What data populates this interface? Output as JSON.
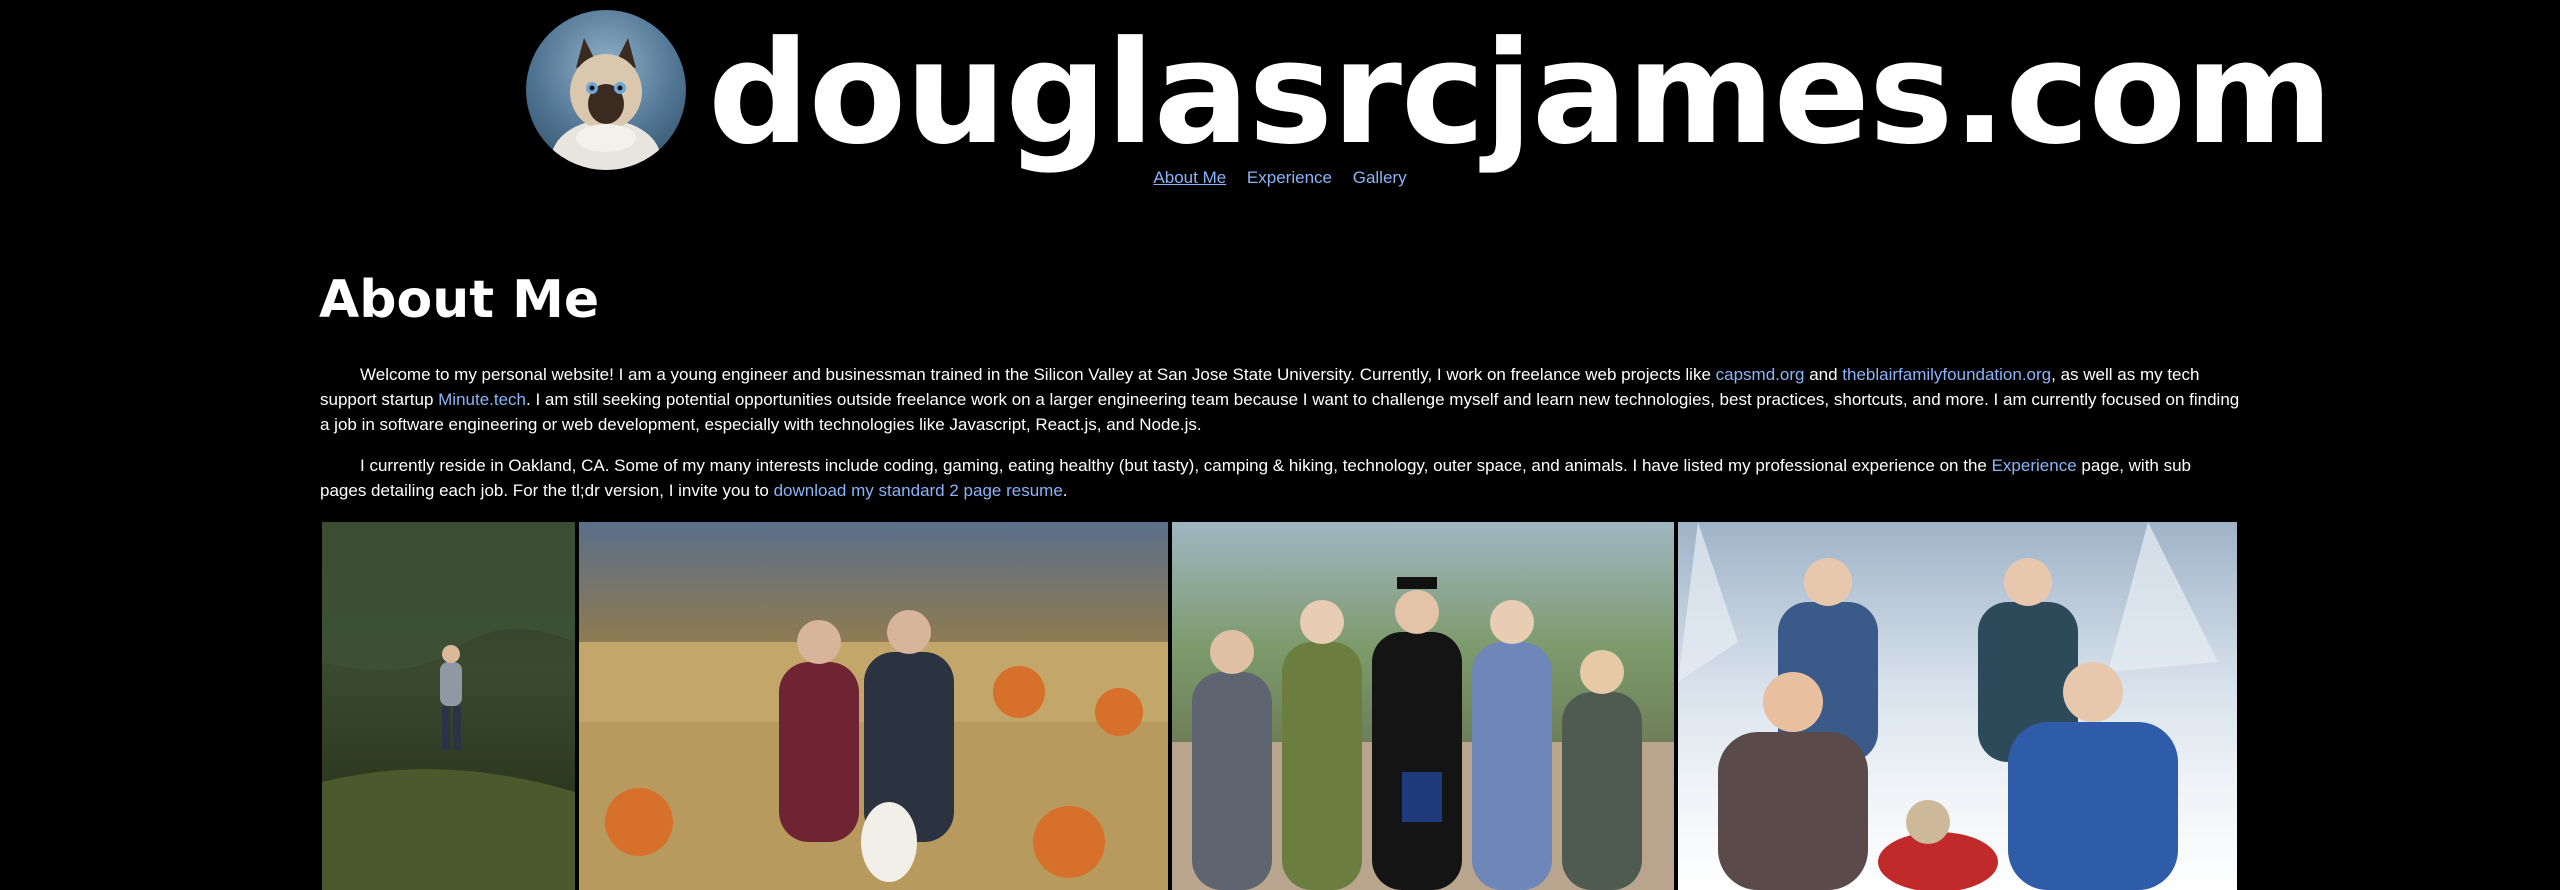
{
  "header": {
    "site_title": "douglasrcjames.com",
    "avatar_alt": "cat avatar"
  },
  "nav": {
    "items": [
      {
        "label": "About Me",
        "active": true
      },
      {
        "label": "Experience",
        "active": false
      },
      {
        "label": "Gallery",
        "active": false
      }
    ]
  },
  "about": {
    "heading": "About Me",
    "para1": {
      "t1": "Welcome to my personal website! I am a young engineer and businessman trained in the Silicon Valley at San Jose State University. Currently, I work on freelance web projects like ",
      "link1": "capsmd.org",
      "t2": " and  ",
      "link2": "theblairfamilyfoundation.org",
      "t3": ", as well as my tech support startup ",
      "link3": "Minute.tech",
      "t4": ". I am still seeking potential opportunities outside freelance work on a larger engineering team because I want to challenge myself and learn new technologies, best practices, shortcuts, and more. I am currently focused on finding a job in software engineering or web development, especially with technologies like Javascript, React.js, and Node.js."
    },
    "para2": {
      "t1": "I currently reside in Oakland, CA. Some of my many interests include coding, gaming, eating healthy (but tasty), camping & hiking, technology, outer space, and animals. I have listed my professional experience on the ",
      "link1": "Experience",
      "t2": " page, with sub pages detailing each job. For the tl;dr version, I invite you to ",
      "link2": "download my standard 2 page resume",
      "t3": "."
    }
  },
  "colors": {
    "background": "#000000",
    "text": "#ffffff",
    "link": "#8ab4f8"
  }
}
